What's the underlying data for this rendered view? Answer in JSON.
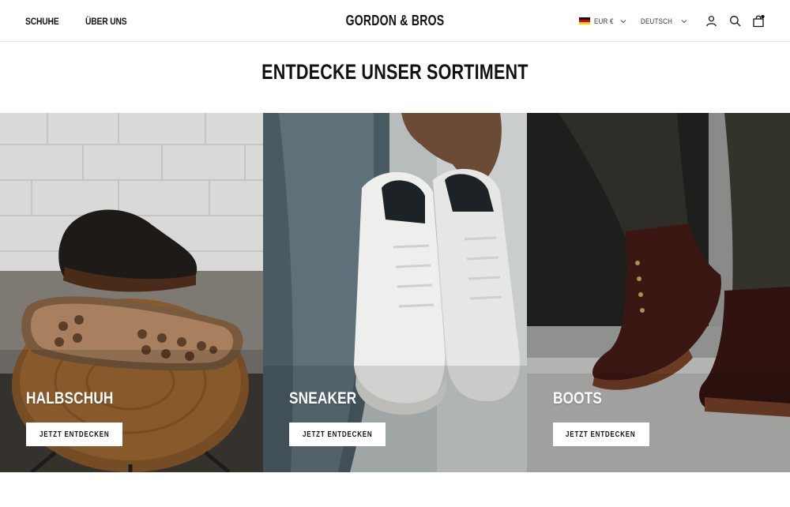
{
  "header": {
    "nav": [
      {
        "label": "SCHUHE"
      },
      {
        "label": "ÜBER UNS"
      }
    ],
    "logo": "GORDON & BROS",
    "currency": {
      "flag": "germany-flag-icon",
      "label": "EUR €"
    },
    "language": {
      "label": "DEUTSCH"
    },
    "icons": [
      "account-icon",
      "search-icon",
      "cart-icon"
    ],
    "cart_has_items": true
  },
  "main": {
    "title": "ENTDECKE UNSER SORTIMENT",
    "collections": [
      {
        "title": "HALBSCHUH",
        "button_label": "JETZT ENTDECKEN",
        "image": "brogue-shoe-on-wooden-stool-image"
      },
      {
        "title": "SNEAKER",
        "button_label": "JETZT ENTDECKEN",
        "image": "white-sneakers-held-in-hand-image"
      },
      {
        "title": "BOOTS",
        "button_label": "JETZT ENTDECKEN",
        "image": "brogue-boots-worn-image"
      }
    ]
  },
  "colors": {
    "text": "#111111",
    "background": "#ffffff",
    "button_bg": "#ffffff",
    "divider": "#e6e6e6"
  }
}
